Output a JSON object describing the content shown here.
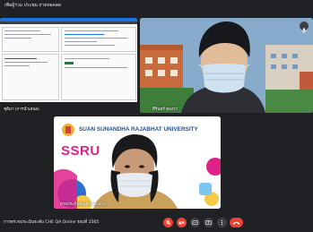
{
  "window": {
    "title": "เพิ่มผู้ร่วม ประชุม ถ่ายทอดสด"
  },
  "tiles": {
    "share": {
      "name": "ชุติมา (การนำเสนอ)"
    },
    "cam1": {
      "name": "ศิรินทร์ ทองวา"
    },
    "cam2": {
      "name": "ฝ่ายประกันคุณภาพ SSRU",
      "banner": "SUAN SUNANDHA RAJABHAT UNIVERSITY",
      "logo_text": "SSRU"
    }
  },
  "meeting": {
    "name": "การตรวจประเมินระดับ CHE QA Online รอบที่ 2565"
  },
  "colors": {
    "accent": "#1a73e8",
    "danger": "#ea4335",
    "brand_pink": "#e0218a",
    "brand_orange": "#f39c4a",
    "brand_blue": "#1f4e9c",
    "brand_yellow": "#f7c948"
  },
  "icons": [
    "mic-off-icon",
    "camera-off-icon",
    "captions-icon",
    "present-icon",
    "more-icon",
    "end-call-icon"
  ]
}
